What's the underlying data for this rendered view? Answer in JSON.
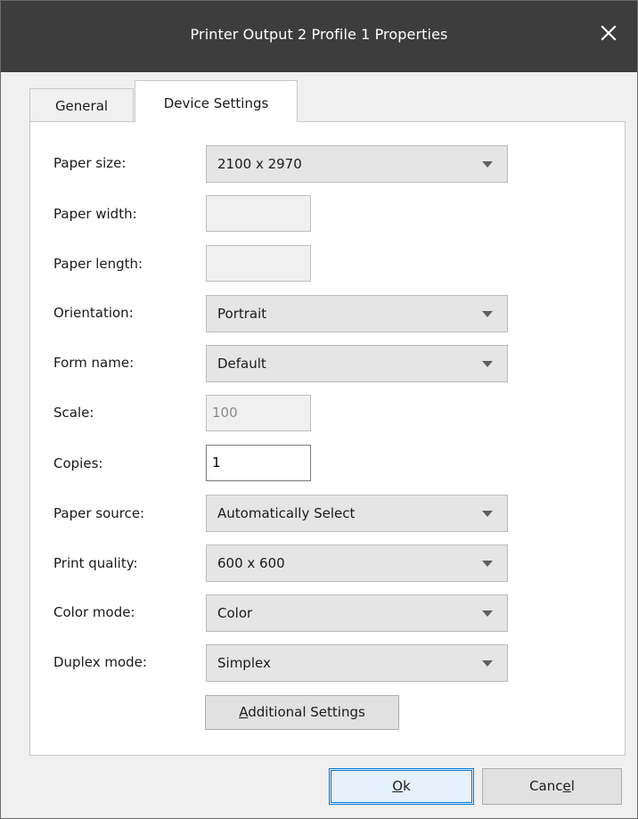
{
  "window": {
    "title": "Printer Output 2 Profile 1 Properties"
  },
  "tabs": [
    {
      "label": "General",
      "selected": false
    },
    {
      "label": "Device Settings",
      "selected": true
    }
  ],
  "fields": {
    "paper_size": {
      "label": "Paper size:",
      "value": "2100 x 2970"
    },
    "paper_width": {
      "label": "Paper width:",
      "value": ""
    },
    "paper_length": {
      "label": "Paper length:",
      "value": ""
    },
    "orientation": {
      "label": "Orientation:",
      "value": "Portrait"
    },
    "form_name": {
      "label": "Form name:",
      "value": "Default"
    },
    "scale": {
      "label": "Scale:",
      "value": "100"
    },
    "copies": {
      "label": "Copies:",
      "value": "1"
    },
    "paper_source": {
      "label": "Paper source:",
      "value": "Automatically Select"
    },
    "print_quality": {
      "label": "Print quality:",
      "value": "600 x 600"
    },
    "color_mode": {
      "label": "Color mode:",
      "value": "Color"
    },
    "duplex_mode": {
      "label": "Duplex mode:",
      "value": "Simplex"
    }
  },
  "buttons": {
    "additional_settings": {
      "mnemonic": "A",
      "rest": "dditional Settings"
    },
    "ok": {
      "mnemonic": "O",
      "rest": "k"
    },
    "cancel": {
      "before": "Canc",
      "mnemonic": "e",
      "after": "l"
    }
  },
  "icons": {
    "close": "close-icon",
    "dropdown": "chevron-down-icon"
  },
  "colors": {
    "titlebar": "#3d3d3d",
    "dialog_bg": "#f0f0f0",
    "panel_bg": "#ffffff",
    "default_button_border": "#0078d7"
  }
}
